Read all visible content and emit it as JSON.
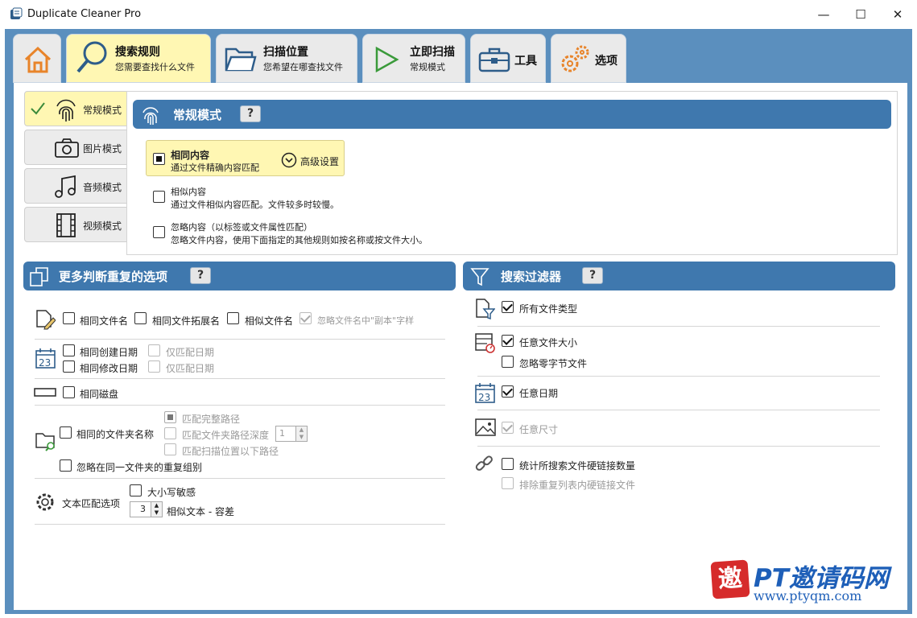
{
  "window": {
    "title": "Duplicate Cleaner Pro",
    "minimize": "—",
    "maximize": "☐",
    "close": "✕"
  },
  "tabs": [
    {
      "title": "",
      "subtitle": ""
    },
    {
      "title": "搜索规则",
      "subtitle": "您需要查找什么文件"
    },
    {
      "title": "扫描位置",
      "subtitle": "您希望在哪查找文件"
    },
    {
      "title": "立即扫描",
      "subtitle": "常规模式"
    },
    {
      "title": "工具",
      "subtitle": ""
    },
    {
      "title": "选项",
      "subtitle": ""
    }
  ],
  "modes": [
    "常规模式",
    "图片模式",
    "音频模式",
    "视频模式"
  ],
  "standard": {
    "header": "常规模式",
    "help": "?",
    "opt1": {
      "title": "相同内容",
      "desc": "通过文件精确内容匹配"
    },
    "advanced": "高级设置",
    "opt2": {
      "title": "相似内容",
      "desc": "通过文件相似内容匹配。文件较多时较慢。"
    },
    "opt3": {
      "title": "忽略内容（以标签或文件属性匹配）",
      "desc": "忽略文件内容，使用下面指定的其他规则如按名称或按文件大小。"
    }
  },
  "more": {
    "header": "更多判断重复的选项",
    "help": "?",
    "same_name": "相同文件名",
    "same_ext": "相同文件拓展名",
    "similar_name": "相似文件名",
    "ignore_copy": "忽略文件名中\"副本\"字样",
    "same_created": "相同创建日期",
    "only_date1": "仅匹配日期",
    "same_modified": "相同修改日期",
    "only_date2": "仅匹配日期",
    "same_disk": "相同磁盘",
    "match_full_path": "匹配完整路径",
    "same_folder_name": "相同的文件夹名称",
    "match_depth": "匹配文件夹路径深度",
    "depth_value": "1",
    "match_below": "匹配扫描位置以下路径",
    "ignore_same_folder": "忽略在同一文件夹的重复组别",
    "text_options": "文本匹配选项",
    "case_sensitive": "大小写敏感",
    "tolerance_value": "3",
    "tolerance_label": "相似文本 - 容差"
  },
  "filters": {
    "header": "搜索过滤器",
    "help": "?",
    "all_types": "所有文件类型",
    "any_size": "任意文件大小",
    "ignore_zero": "忽略零字节文件",
    "any_date": "任意日期",
    "any_dim": "任意尺寸",
    "hardlinks": "统计所搜索文件硬链接数量",
    "exclude_hardlinks": "排除重复列表内硬链接文件"
  },
  "watermark": {
    "text": "PT邀请码网",
    "url": "www.ptyqm.com",
    "seal": "邀"
  },
  "colors": {
    "accent": "#3f78ae",
    "tabbar": "#5b8fbe",
    "active": "#fff7b3"
  }
}
